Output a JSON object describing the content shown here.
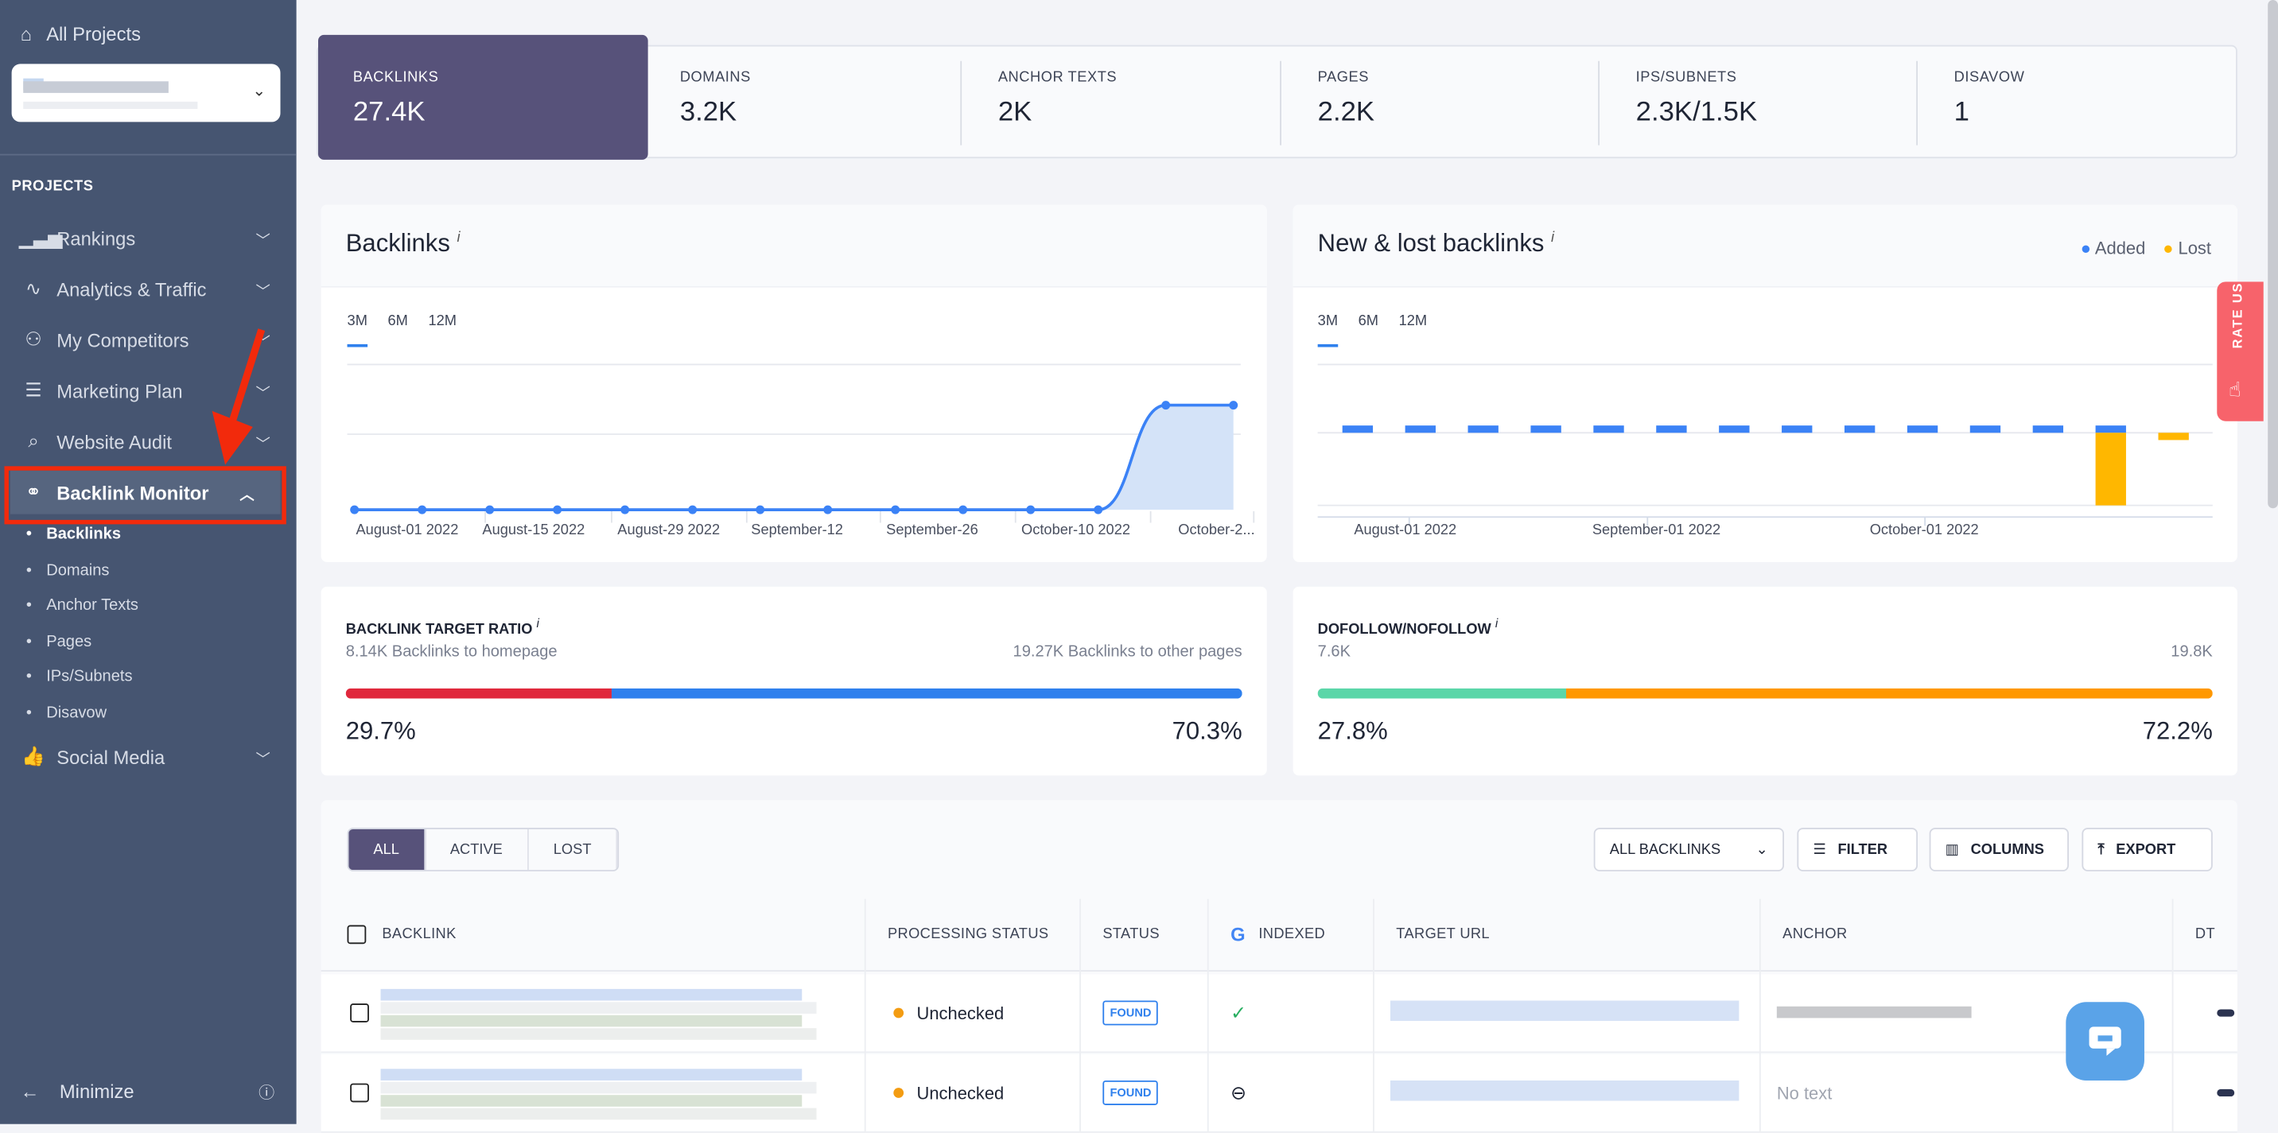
{
  "sidebar": {
    "all_projects": "All Projects",
    "section": "PROJECTS",
    "items": [
      {
        "label": "Rankings",
        "icon": "bar-chart-icon"
      },
      {
        "label": "Analytics & Traffic",
        "icon": "pulse-icon"
      },
      {
        "label": "My Competitors",
        "icon": "users-icon"
      },
      {
        "label": "Marketing Plan",
        "icon": "checklist-icon"
      },
      {
        "label": "Website Audit",
        "icon": "audit-icon"
      },
      {
        "label": "Backlink Monitor",
        "icon": "link-icon"
      },
      {
        "label": "Social Media",
        "icon": "thumbs-up-icon"
      }
    ],
    "subitems": [
      "Backlinks",
      "Domains",
      "Anchor Texts",
      "Pages",
      "IPs/Subnets",
      "Disavow"
    ],
    "minimize": "Minimize"
  },
  "stats": [
    {
      "label": "BACKLINKS",
      "value": "27.4K"
    },
    {
      "label": "DOMAINS",
      "value": "3.2K"
    },
    {
      "label": "ANCHOR TEXTS",
      "value": "2K"
    },
    {
      "label": "PAGES",
      "value": "2.2K"
    },
    {
      "label": "IPS/SUBNETS",
      "value": "2.3K/1.5K"
    },
    {
      "label": "DISAVOW",
      "value": "1"
    }
  ],
  "ranges": [
    "3M",
    "6M",
    "12M"
  ],
  "backlinks_chart": {
    "title": "Backlinks",
    "info": "i"
  },
  "newlost_chart": {
    "title": "New & lost backlinks",
    "info": "i",
    "legend": [
      "Added",
      "Lost"
    ]
  },
  "chart_data": [
    {
      "type": "area",
      "title": "Backlinks",
      "x": [
        "August-01 2022",
        "August-15 2022",
        "August-29 2022",
        "September-12",
        "September-26",
        "October-10 2022",
        "October-2..."
      ],
      "points": [
        0,
        0,
        0,
        0,
        0,
        0,
        0,
        0,
        0,
        0,
        0,
        0,
        1,
        1
      ],
      "color": "#3b82f6"
    },
    {
      "type": "bar",
      "title": "New & lost backlinks",
      "x": [
        "August-01 2022",
        "September-01 2022",
        "October-01 2022"
      ],
      "series": [
        {
          "name": "Added",
          "color": "#3b82f6",
          "values": [
            1,
            1,
            1,
            1,
            1,
            1,
            1,
            1,
            1,
            1,
            1,
            1,
            1,
            0
          ]
        },
        {
          "name": "Lost",
          "color": "#ffb700",
          "values": [
            0,
            0,
            0,
            0,
            0,
            0,
            0,
            0,
            0,
            0,
            0,
            0,
            -10,
            -1
          ]
        }
      ]
    }
  ],
  "target_ratio": {
    "title": "BACKLINK TARGET RATIO",
    "info": "i",
    "left": "8.14K Backlinks to homepage",
    "right": "19.27K Backlinks to other pages",
    "left_pct": "29.7%",
    "right_pct": "70.3%",
    "left_value": 29.7,
    "left_color": "#e0283c",
    "right_color": "#2f80ed"
  },
  "follow_ratio": {
    "title": "DOFOLLOW/NOFOLLOW",
    "info": "i",
    "left": "7.6K",
    "right": "19.8K",
    "left_pct": "27.8%",
    "right_pct": "72.2%",
    "left_value": 27.8,
    "left_color": "#5bd6a8",
    "right_color": "#ff9800"
  },
  "table": {
    "tabs": [
      "ALL",
      "ACTIVE",
      "LOST"
    ],
    "dropdown": "ALL BACKLINKS",
    "filter": "FILTER",
    "columns_btn": "COLUMNS",
    "export": "EXPORT",
    "columns": [
      "BACKLINK",
      "PROCESSING STATUS",
      "STATUS",
      "INDEXED",
      "TARGET URL",
      "ANCHOR",
      "DT"
    ],
    "rows": [
      {
        "processing": "Unchecked",
        "status": "FOUND",
        "indexed": "check",
        "anchor": ""
      },
      {
        "processing": "Unchecked",
        "status": "FOUND",
        "indexed": "minus",
        "anchor": "No text"
      }
    ]
  },
  "rate_us": "RATE US"
}
